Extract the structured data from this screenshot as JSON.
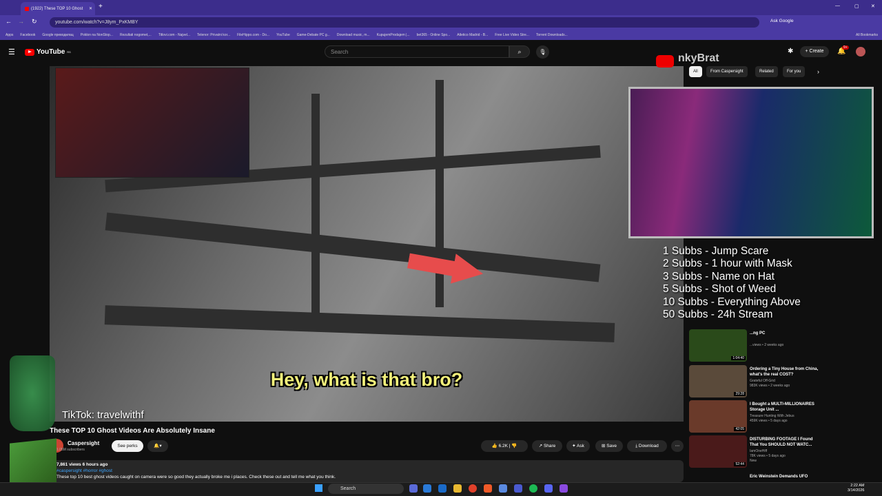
{
  "browser": {
    "tab_title": "(1922) These TOP 10 Ghost",
    "url": "youtube.com/watch?v=J8ym_PxKMBY",
    "ask_google": "Ask Google",
    "bookmarks": [
      "Apps",
      "Facebook",
      "Google преводилац",
      "Poklon na NonStop...",
      "Rezultati nogomet,...",
      "Titlovi.com - Najvel...",
      "Telenor: Privatni kor...",
      "FileHippo.com - Do...",
      "YouTube",
      "Game-Debate PC g...",
      "Download music, m...",
      "KupujemProdajem |...",
      "bet365 - Online Spo...",
      "Atletico Madrid - B...",
      "Free Live Video Stre...",
      "Torrent Downloads..."
    ],
    "all_bookmarks": "All Bookmarks"
  },
  "youtube": {
    "logo": "YouTube",
    "region": "RS",
    "search_placeholder": "Search",
    "create": "Create",
    "notif_count": "9+"
  },
  "chips": [
    "All",
    "From Caspersight",
    "Related",
    "For you"
  ],
  "video": {
    "subtitle": "Hey, what is that bro?",
    "tiktok": "TikTok: travelwithf",
    "title": "These TOP 10 Ghost Videos Are Absolutely Insane",
    "channel": "Caspersight",
    "subscribers": "1.05M subscribers",
    "see_perks": "See perks",
    "likes": "6.2K",
    "share": "Share",
    "ask": "Ask",
    "save": "Save",
    "download": "Download",
    "views_line": "7,861 views  6 hours ago  #caspersight #horror #ghost",
    "tags": "#caspersight #horror #ghost",
    "description": "These top 10 best ghost videos caught on camera were so good they actually broke me i places. Check these out and tell me what you think."
  },
  "stream": {
    "brand": "nkyBrat",
    "goals": [
      "1 Subbs - Jump Scare",
      "2 Subbs - 1 hour with Mask",
      "3 Subbs - Name on Hat",
      "5 Subbs - Shot of Weed",
      "10 Subbs - Everything Above",
      "50 Subbs - 24h Stream"
    ]
  },
  "recommendations": [
    {
      "title": "...ng PC",
      "meta": "...views • 2 weeks ago",
      "duration": "1:04:40"
    },
    {
      "title": "Ordering a Tiny House from China, what's the real COST?",
      "meta": "Grateful Off-Grid\n983K views • 2 weeks ago",
      "duration": "29:28"
    },
    {
      "title": "I Bought a MULTI-MILLIONAIRES Storage Unit ...",
      "meta": "Treasure Hunting With Jebus\n459K views • 5 days ago",
      "duration": "42:05"
    },
    {
      "title": "DISTURBING FOOTAGE I Found That You SHOULD NOT WATC...",
      "meta": "IamOneHiff\n78K views • 5 days ago\nNew",
      "duration": "52:44"
    },
    {
      "title": "Eric Weinstein Demands UFO",
      "meta": "",
      "duration": ""
    }
  ],
  "taskbar": {
    "search": "Search",
    "time": "2:22 AM",
    "date": "3/14/2026"
  }
}
